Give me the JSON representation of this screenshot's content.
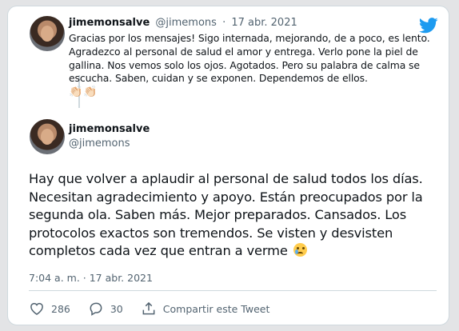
{
  "reply": {
    "name": "jimemonsalve",
    "handle": "@jimemons",
    "separator": "·",
    "date": "17 abr. 2021",
    "text": "Gracias por los mensajes! Sigo internada, mejorando, de a poco, es lento. Agradezco al personal de salud el amor y entrega. Verlo pone la piel de gallina. Nos vemos solo los ojos. Agotados. Pero su palabra de calma se escucha. Saben, cuidan y se exponen. Dependemos de ellos.",
    "emoji": "👏🏻👏🏻"
  },
  "main": {
    "name": "jimemonsalve",
    "handle": "@jimemons",
    "text": "Hay que volver a aplaudir al personal de salud todos los días. Necesitan agradecimiento y apoyo. Están preocupados por la segunda ola. Saben más. Mejor preparados. Cansados. Los protocolos exactos son tremendos. Se visten y desvisten completos cada vez que entran a verme",
    "timestamp": "7:04 a. m. · 17 abr. 2021"
  },
  "actions": {
    "likes": "286",
    "replies": "30",
    "share_label": "Compartir este Tweet"
  },
  "icons": {
    "brand": "twitter-bird-icon",
    "like": "heart-icon",
    "reply": "speech-bubble-icon",
    "share": "share-icon",
    "emoji": "sad-tear-emoji-icon"
  },
  "colors": {
    "twitter_blue": "#1d9bf0",
    "text": "#0f1419",
    "muted": "#536471",
    "border": "#cfd9de"
  }
}
